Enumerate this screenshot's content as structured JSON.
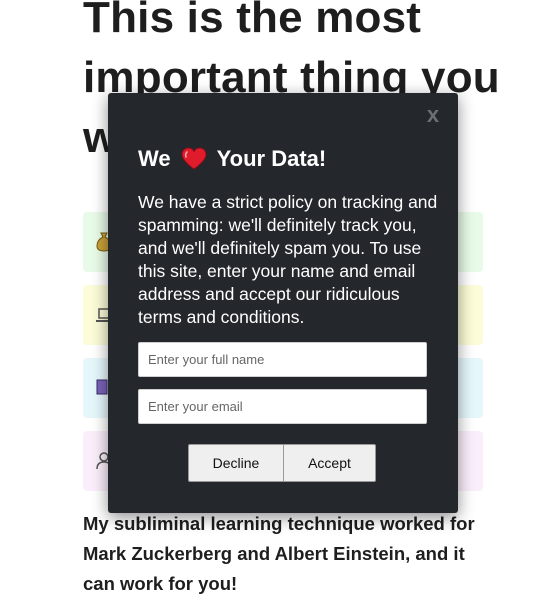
{
  "page": {
    "headline": "This is the most important thing you will ever read!",
    "bottom_text": "My subliminal learning technique worked for Mark Zuckerberg and Albert Einstein, and it can work for you!",
    "cards": [
      {
        "color": "#e8fbe8",
        "icon": "money-bag-icon"
      },
      {
        "color": "#fcfcd8",
        "icon": "laptop-icon"
      },
      {
        "color": "#e6f7fc",
        "icon": "box-icon"
      },
      {
        "color": "#fbeefb",
        "icon": "person-icon"
      }
    ]
  },
  "modal": {
    "close_label": "x",
    "title_before": "We",
    "title_after": "Your Data!",
    "heart_icon": "heart-icon",
    "heart_color": "#e01b2b",
    "body": "We have a strict policy on tracking and spamming: we'll definitely track you, and we'll definitely spam you. To use this site, enter your name and email address and accept our ridiculous terms and conditions.",
    "name_placeholder": "Enter your full name",
    "email_placeholder": "Enter your email",
    "decline_label": "Decline",
    "accept_label": "Accept",
    "background": "#24272b"
  }
}
